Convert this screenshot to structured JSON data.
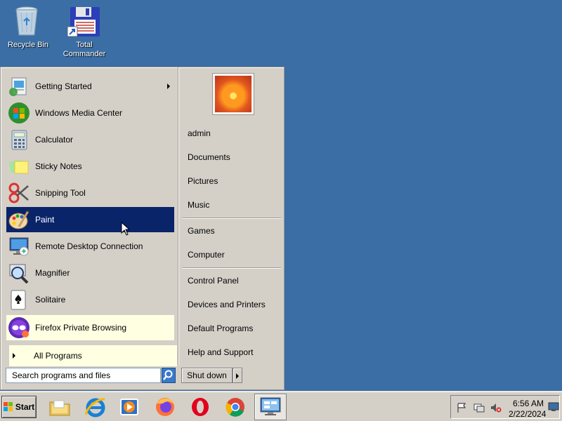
{
  "desktop": {
    "icons": [
      {
        "label": "Recycle Bin"
      },
      {
        "label": "Total Commander"
      }
    ]
  },
  "start_menu": {
    "programs": [
      {
        "label": "Getting Started",
        "icon": "getting-started-icon",
        "has_submenu": true
      },
      {
        "label": "Windows Media Center",
        "icon": "windows-media-center-icon"
      },
      {
        "label": "Calculator",
        "icon": "calculator-icon"
      },
      {
        "label": "Sticky Notes",
        "icon": "sticky-notes-icon"
      },
      {
        "label": "Snipping Tool",
        "icon": "snipping-tool-icon"
      },
      {
        "label": "Paint",
        "icon": "paint-icon",
        "selected": true
      },
      {
        "label": "Remote Desktop Connection",
        "icon": "remote-desktop-icon"
      },
      {
        "label": "Magnifier",
        "icon": "magnifier-icon"
      },
      {
        "label": "Solitaire",
        "icon": "solitaire-icon"
      },
      {
        "label": "Firefox Private Browsing",
        "icon": "firefox-private-icon",
        "pinned": true
      }
    ],
    "all_programs": "All Programs",
    "search_placeholder": "Search programs and files",
    "right_items": {
      "user": "admin",
      "documents": "Documents",
      "pictures": "Pictures",
      "music": "Music",
      "games": "Games",
      "computer": "Computer",
      "control_panel": "Control Panel",
      "devices": "Devices and Printers",
      "default_programs": "Default Programs",
      "help": "Help and Support"
    },
    "shutdown_label": "Shut down"
  },
  "taskbar": {
    "start_label": "Start",
    "apps": [
      {
        "icon": "file-explorer-icon"
      },
      {
        "icon": "internet-explorer-icon"
      },
      {
        "icon": "media-player-icon"
      },
      {
        "icon": "firefox-icon"
      },
      {
        "icon": "opera-icon"
      },
      {
        "icon": "chrome-icon"
      },
      {
        "icon": "remote-desktop-taskbar-icon",
        "active": true
      }
    ],
    "clock": {
      "time": "6:56 AM",
      "date": "2/22/2024"
    }
  },
  "colors": {
    "desktop": "#3a6ea5",
    "selection": "#0a246a",
    "pinned_bg": "#ffffe1",
    "chrome": "#d4d0c8"
  }
}
